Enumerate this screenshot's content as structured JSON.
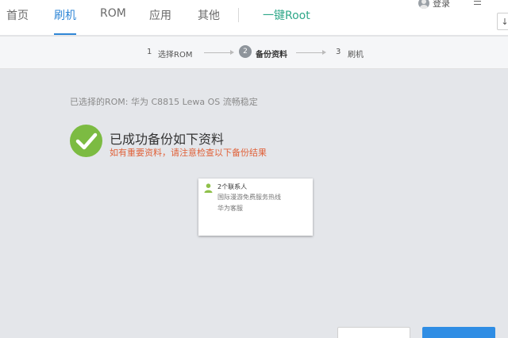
{
  "nav": {
    "tabs": [
      {
        "label": "首页"
      },
      {
        "label": "刷机"
      },
      {
        "label": "ROM"
      },
      {
        "label": "应用"
      },
      {
        "label": "其他"
      }
    ],
    "root_tab": "一键Root",
    "login_label": "登录",
    "active_tab": "刷机",
    "accent_color": "#2f86d6",
    "root_color": "#2fa889"
  },
  "steps": [
    {
      "num": "1",
      "label": "选择ROM"
    },
    {
      "num": "2",
      "label": "备份资料",
      "current": true
    },
    {
      "num": "3",
      "label": "刷机"
    }
  ],
  "content": {
    "selected_rom": "已选择的ROM:  华为 C8815 Lewa OS 流畅稳定",
    "success_title": "已成功备份如下资料",
    "warning": "如有重要资料，请注意检查以下备份结果",
    "success_color": "#7cbb42",
    "warning_color": "#e0623a"
  },
  "backup_card": {
    "title": "2个联系人",
    "items": [
      "国际漫游免费服务热线",
      "华为客服"
    ],
    "icon": "contact-person-icon"
  },
  "footer": {
    "secondary_label": "",
    "primary_label": ""
  }
}
